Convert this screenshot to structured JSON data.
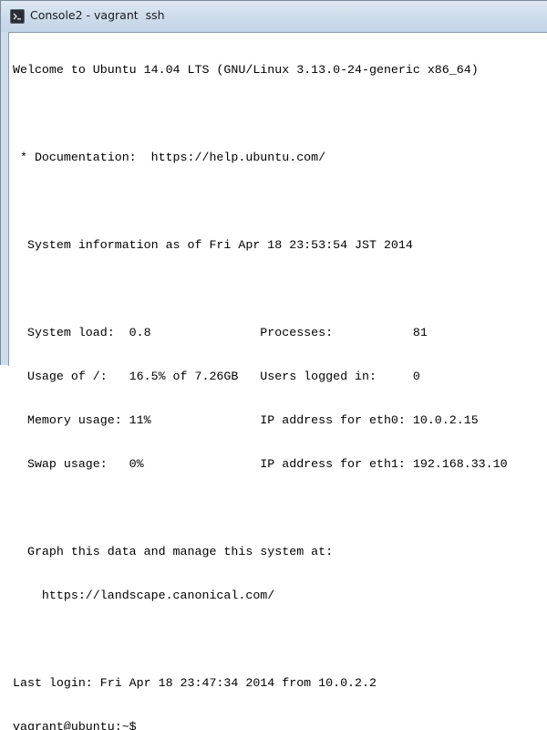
{
  "window": {
    "title": "Console2 - vagrant  ssh"
  },
  "terminal": {
    "lines": [
      "Welcome to Ubuntu 14.04 LTS (GNU/Linux 3.13.0-24-generic x86_64)",
      "",
      " * Documentation:  https://help.ubuntu.com/",
      "",
      "  System information as of Fri Apr 18 23:53:54 JST 2014",
      "",
      "  System load:  0.8               Processes:           81",
      "  Usage of /:   16.5% of 7.26GB   Users logged in:     0",
      "  Memory usage: 11%               IP address for eth0: 10.0.2.15",
      "  Swap usage:   0%                IP address for eth1: 192.168.33.10",
      "",
      "  Graph this data and manage this system at:",
      "    https://landscape.canonical.com/",
      "",
      "Last login: Fri Apr 18 23:47:34 2014 from 10.0.2.2",
      "vagrant@ubuntu:~$"
    ]
  }
}
